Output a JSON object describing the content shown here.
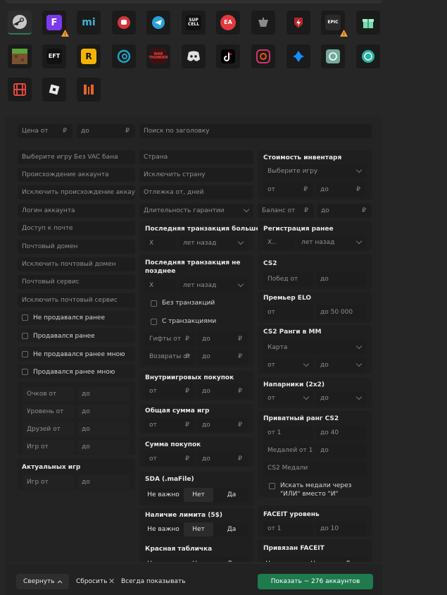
{
  "icons": [
    "steam-icon",
    "fortnite-icon",
    "mihoyo-icon",
    "riot-icon",
    "telegram-icon",
    "supercell-icon",
    "ea-icon",
    "world-of-tanks-icon",
    "wot-blitz-icon",
    "epic-games-icon",
    "gift-icon",
    "minecraft-icon",
    "escape-from-tarkov-icon",
    "rockstar-icon",
    "uplay-icon",
    "war-thunder-icon",
    "discord-icon",
    "tiktok-icon",
    "instagram-icon",
    "battlenet-icon",
    "chatgpt-icon",
    "vpn-icon",
    "roblox-icon-red",
    "roblox-icon",
    "warface-icon"
  ],
  "icon_texts": {
    "fortnite": "F",
    "epic": "EPIC",
    "supercell": "SUP CELL",
    "ea": "EA",
    "warthunder": "WAR THUNDER",
    "rockstar": "R",
    "tarkov": "EFT",
    "mihoyo": "mi"
  },
  "filters": {
    "price_from": "Цена от",
    "price_to": "до",
    "currency": "₽",
    "search_title": "Поиск по заголовку",
    "select_game_vac": "Выберите игру Без VAC бана",
    "origin": "Происхождение аккаунта",
    "exclude_origin": "Исключить происхождение аккаунта",
    "login": "Логин аккаунта",
    "mail_access": "Доступ к почте",
    "mail_domain": "Почтовый домен",
    "exclude_mail_domain": "Исключить почтовый домен",
    "mail_service": "Почтовый сервис",
    "exclude_mail_service": "Исключить почтовый сервис",
    "not_sold_before": "Не продавался ранее",
    "sold_before": "Продавался ранее",
    "not_sold_by_me": "Не продавался ранее мною",
    "sold_by_me": "Продавался ранее мною",
    "points_from": "Очков от",
    "level_from": "Уровень от",
    "friends_from": "Друзей от",
    "games_from": "Игр от",
    "to": "до",
    "actual_games": "Актуальных игр",
    "actual_games_from": "Игр от",
    "country": "Страна",
    "exclude_country": "Исключить страну",
    "inactive_days": "Отлежка от, дней",
    "warranty": "Длительность гарантии",
    "last_tx_more": "Последняя транзакция больше",
    "x": "X",
    "years_ago": "лет назад",
    "last_tx_not_later": "Последняя транзакция не позднее",
    "no_tx": "Без транзакций",
    "with_tx": "С транзакциями",
    "gifts_from": "Гифты от",
    "refunds_from": "Возвраты от",
    "ingame_purchases": "Внутриигровых покупок",
    "from": "от",
    "total_games": "Общая сумма игр",
    "purchases_sum": "Сумма покупок",
    "sda": "SDA (.maFile)",
    "not_important": "Не важно",
    "no": "Нет",
    "yes": "Да",
    "limit": "Наличие лимита (5$)",
    "red_table": "Красная табличка",
    "inventory_value": "Стоимость инвентаря",
    "select_game": "Выберите игру",
    "balance_from": "Баланс от",
    "registered_before": "Регистрация ранее",
    "x_dots": "X..",
    "cs2": "CS2",
    "wins_from": "Побед от",
    "premier_elo": "Премьер ELO",
    "to_50000": "до 50 000",
    "cs2_ranks": "CS2 Ранги в ММ",
    "map": "Карта",
    "teammates": "Напарники (2x2)",
    "private_rank": "Приватный ранг CS2",
    "from_1": "от 1",
    "to_40": "до 40",
    "medals_from": "Медалей от 1",
    "cs2_medals": "CS2 Медали",
    "or_medals": "Искать медали через \"ИЛИ\" вместо \"И\"",
    "faceit_level": "FACEIT уровень",
    "to_10": "до 10",
    "faceit_linked": "Привязан FACEIT"
  },
  "bottom": {
    "collapse": "Свернуть",
    "reset": "Сбросить",
    "always_show": "Всегда показывать",
    "show_button": "Показать ~ 276 аккаунтов"
  },
  "colors": {
    "accent": "#1f7a4d",
    "warning": "#f0a030"
  }
}
